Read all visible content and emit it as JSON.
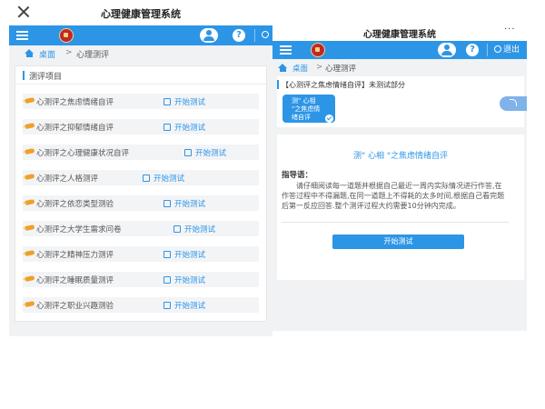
{
  "left": {
    "app_title": "心理健康管理系统",
    "logout_label": "",
    "breadcrumb": {
      "home": "桌面",
      "separator": ">",
      "current": "心理测评"
    },
    "section_title": "测评项目",
    "start_label": "开始测试",
    "tests": [
      "心测评之焦虑情绪自评",
      "心测评之抑郁情绪自评",
      "心测评之心理健康状况自评",
      "心测评之人格测评",
      "心测评之依恋类型测验",
      "心测评之大学生需求问卷",
      "心测评之精神压力测评",
      "心测评之睡眠质量测评",
      "心测评之职业兴趣测验"
    ]
  },
  "right": {
    "app_title": "心理健康管理系统",
    "more": "···",
    "logout_label": "退出",
    "breadcrumb": {
      "home": "桌面",
      "separator": ">",
      "current": "心理测评"
    },
    "subject_info": "【心测评之焦虑情绪自评】未测试部分",
    "chip_label": "测\" 心相\n\"之焦虑情\n绪自评",
    "test_title": "测\" 心相 \"之焦虑情绪自评",
    "guide_label": "指导语：",
    "guide_text": "请仔细阅读每一道题并根据自己最近一周内实际情况进行作答,在作答过程中不得漏题,在同一道题上不得耗的太多时间,根据自己看完题后第一反应回答.整个测评过程大约需要10分钟内完成。",
    "start_button": "开始测试"
  },
  "colors": {
    "accent": "#2d95e6",
    "background": "#f1f2f4"
  }
}
